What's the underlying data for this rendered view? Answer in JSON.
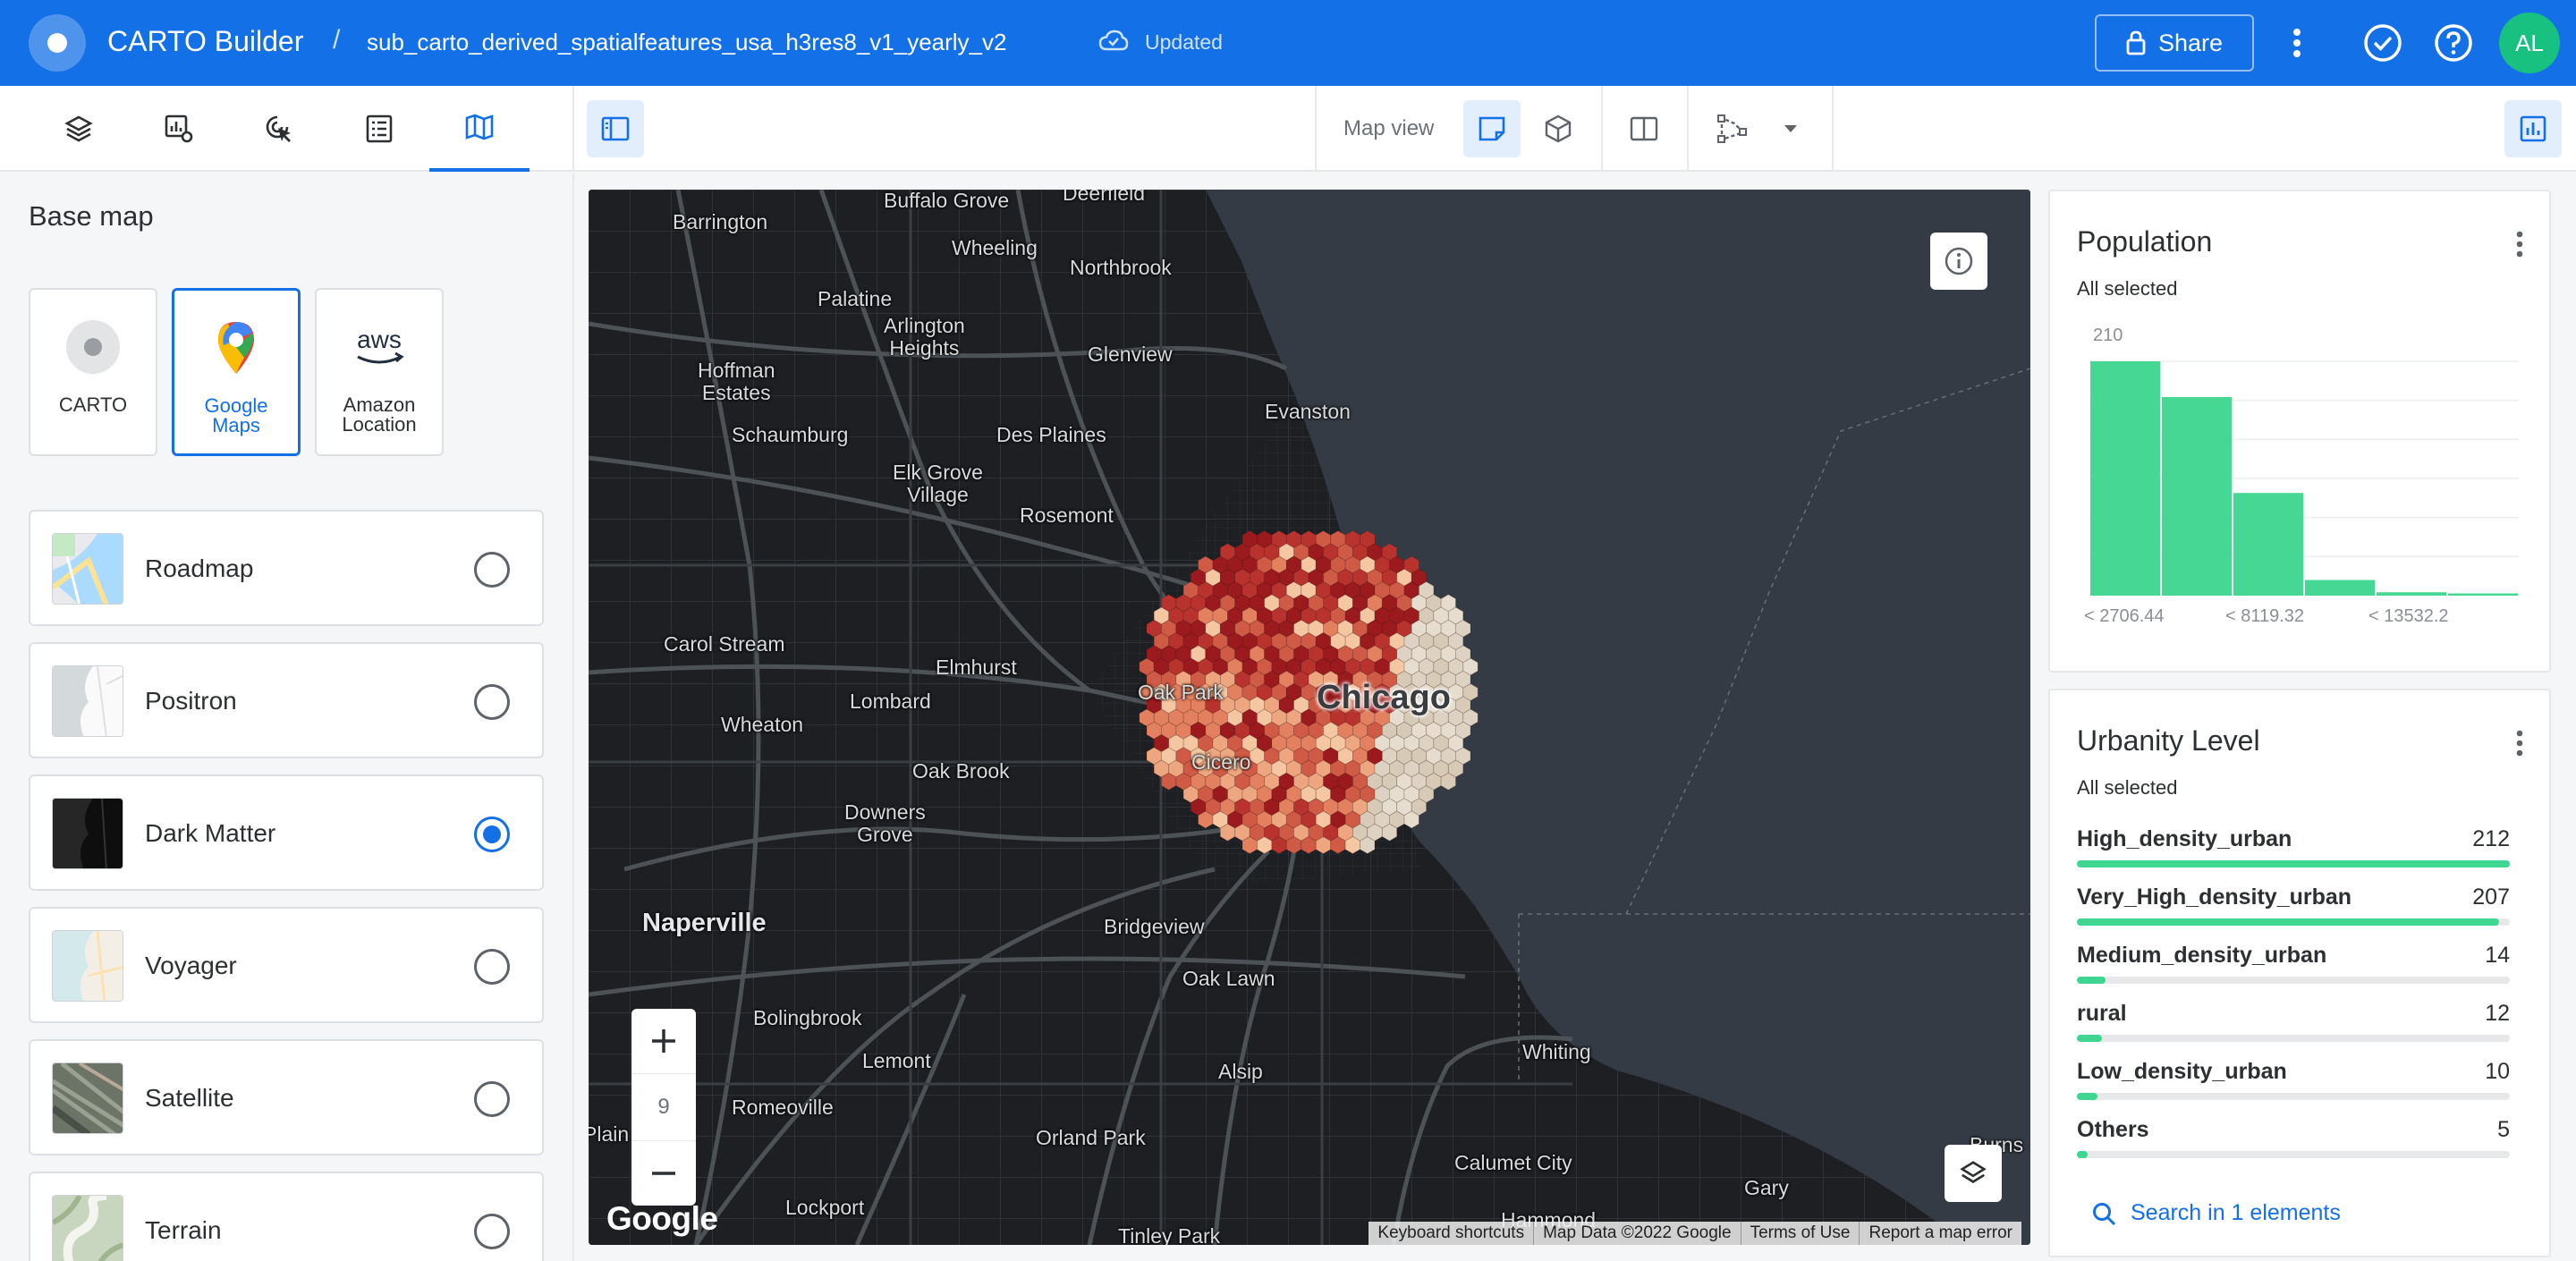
{
  "header": {
    "app_title": "CARTO Builder",
    "separator": "/",
    "map_title": "sub_carto_derived_spatialfeatures_usa_h3res8_v1_yearly_v2",
    "status": "Updated",
    "share_label": "Share",
    "avatar_initials": "AL",
    "icons": [
      "cloud-icon",
      "lock-icon",
      "more-vert-icon",
      "check-circle-icon",
      "help-icon"
    ]
  },
  "toolbar": {
    "tabs": [
      "layers-tab",
      "widgets-tab",
      "interactions-tab",
      "legend-tab",
      "basemap-tab"
    ],
    "active_tab": "basemap-tab",
    "map_view_label": "Map view"
  },
  "left_panel": {
    "heading": "Base map",
    "providers": [
      {
        "label": "CARTO",
        "selected": false
      },
      {
        "label": "Google\nMaps",
        "selected": true
      },
      {
        "label": "Amazon\nLocation",
        "selected": false
      }
    ],
    "styles": [
      {
        "name": "Roadmap",
        "selected": false
      },
      {
        "name": "Positron",
        "selected": false
      },
      {
        "name": "Dark Matter",
        "selected": true
      },
      {
        "name": "Voyager",
        "selected": false
      },
      {
        "name": "Satellite",
        "selected": false
      },
      {
        "name": "Terrain",
        "selected": false
      }
    ]
  },
  "map": {
    "zoom_level": "9",
    "google_logo": "Google",
    "attribution": [
      "Keyboard shortcuts",
      "Map Data ©2022 Google",
      "Terms of Use",
      "Report a map error"
    ],
    "places": {
      "barrington": "Barrington",
      "buffalo_grove": "Buffalo Grove",
      "deerfield": "Deerfield",
      "wheeling": "Wheeling",
      "northbrook": "Northbrook",
      "palatine": "Palatine",
      "arlington_heights": "Arlington\nHeights",
      "hoffman_estates": "Hoffman\nEstates",
      "glenview": "Glenview",
      "evanston": "Evanston",
      "schaumburg": "Schaumburg",
      "des_plaines": "Des Plaines",
      "elk_grove_village": "Elk Grove\nVillage",
      "rosemont": "Rosemont",
      "carol_stream": "Carol Stream",
      "elmhurst": "Elmhurst",
      "lombard": "Lombard",
      "wheaton": "Wheaton",
      "oak_park": "Oak Park",
      "chicago": "Chicago",
      "cicero": "Cicero",
      "oak_brook": "Oak Brook",
      "downers_grove": "Downers\nGrove",
      "naperville": "Naperville",
      "bridgeview": "Bridgeview",
      "oak_lawn": "Oak Lawn",
      "bolingbrook": "Bolingbrook",
      "lemont": "Lemont",
      "alsip": "Alsip",
      "whiting": "Whiting",
      "romeoville": "Romeoville",
      "orland_park": "Orland Park",
      "calumet_city": "Calumet City",
      "gary": "Gary",
      "plain": "Plain",
      "burns": "Burns",
      "lockport": "Lockport",
      "tinley_park": "Tinley Park",
      "hammond": "Hammond"
    }
  },
  "widgets": {
    "population": {
      "title": "Population",
      "subtitle": "All selected",
      "max_label": "210",
      "tick_labels": [
        "< 2706.44",
        "< 8119.32",
        "< 13532.2"
      ],
      "bar_color": "#47d795",
      "bins": [
        210,
        178,
        92,
        14,
        3,
        2
      ]
    },
    "urbanity": {
      "title": "Urbanity Level",
      "subtitle": "All selected",
      "bar_color": "#3fd692",
      "categories": [
        {
          "name": "High_density_urban",
          "value": "212",
          "fraction": 1.0
        },
        {
          "name": "Very_High_density_urban",
          "value": "207",
          "fraction": 0.976
        },
        {
          "name": "Medium_density_urban",
          "value": "14",
          "fraction": 0.066
        },
        {
          "name": "rural",
          "value": "12",
          "fraction": 0.057
        },
        {
          "name": "Low_density_urban",
          "value": "10",
          "fraction": 0.047
        },
        {
          "name": "Others",
          "value": "5",
          "fraction": 0.024
        }
      ],
      "search_label": "Search in 1 elements"
    }
  },
  "colors": {
    "brand": "#1370e6",
    "accent_green": "#47d795",
    "map_bg": "#1e2024",
    "water": "#353b44"
  }
}
